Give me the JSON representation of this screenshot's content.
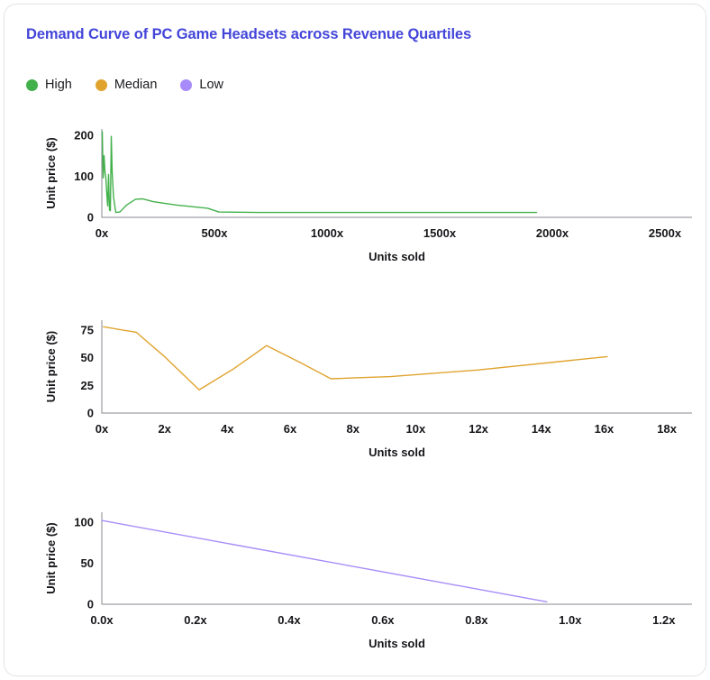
{
  "card": {
    "title": "Demand Curve of PC Game Headsets across Revenue Quartiles",
    "title_color": "#4345d9",
    "background": "#ffffff",
    "border_color": "#e3e3e8"
  },
  "legend": {
    "position": "top-left",
    "items": [
      {
        "label": "High",
        "color": "#43b14b"
      },
      {
        "label": "Median",
        "color": "#e0a32e"
      },
      {
        "label": "Low",
        "color": "#a78bfa"
      }
    ]
  },
  "chart_data": [
    {
      "type": "line",
      "title": "Demand Curve of PC Game Headsets across Revenue Quartiles",
      "series_name": "High",
      "color": "#43b14b",
      "xlabel": "Units sold",
      "ylabel": "Unit price ($)",
      "xlim": [
        0,
        2620
      ],
      "ylim": [
        0,
        215
      ],
      "xticks": [
        0,
        500,
        1000,
        1500,
        2000,
        2500
      ],
      "xticklabels": [
        "0x",
        "500x",
        "1000x",
        "1500x",
        "2000x",
        "2500x"
      ],
      "yticks": [
        0,
        100,
        200
      ],
      "yticklabels": [
        "0",
        "100",
        "200"
      ],
      "grid": false,
      "x": [
        2,
        6,
        10,
        14,
        18,
        22,
        26,
        30,
        34,
        38,
        42,
        46,
        52,
        62,
        80,
        110,
        150,
        180,
        230,
        330,
        470,
        520,
        700,
        1000,
        1400,
        1700,
        1930
      ],
      "y": [
        208,
        96,
        150,
        110,
        96,
        58,
        28,
        104,
        18,
        16,
        197,
        110,
        50,
        12,
        13,
        30,
        44,
        45,
        38,
        30,
        22,
        13,
        12,
        12,
        12,
        12,
        12
      ]
    },
    {
      "type": "line",
      "series_name": "Median",
      "color": "#e0a32e",
      "xlabel": "Units sold",
      "ylabel": "Unit price ($)",
      "xlim": [
        0,
        18.8
      ],
      "ylim": [
        0,
        84
      ],
      "xticks": [
        0,
        2,
        4,
        6,
        8,
        10,
        12,
        14,
        16,
        18
      ],
      "xticklabels": [
        "0x",
        "2x",
        "4x",
        "6x",
        "8x",
        "10x",
        "12x",
        "14x",
        "16x",
        "18x"
      ],
      "yticks": [
        0,
        25,
        50,
        75
      ],
      "yticklabels": [
        "0",
        "25",
        "50",
        "75"
      ],
      "grid": false,
      "x": [
        0.05,
        1.1,
        2.0,
        3.1,
        4.2,
        5.25,
        6.3,
        7.3,
        9.2,
        12.0,
        16.1
      ],
      "y": [
        78,
        73,
        51,
        21,
        40,
        61,
        46,
        31,
        33,
        39,
        51
      ]
    },
    {
      "type": "line",
      "series_name": "Low",
      "color": "#a78bfa",
      "xlabel": "Units sold",
      "ylabel": "Unit price ($)",
      "xlim": [
        0,
        1.26
      ],
      "ylim": [
        0,
        112
      ],
      "xticks": [
        0.0,
        0.2,
        0.4,
        0.6,
        0.8,
        1.0,
        1.2
      ],
      "xticklabels": [
        "0.0x",
        "0.2x",
        "0.4x",
        "0.6x",
        "0.8x",
        "1.0x",
        "1.2x"
      ],
      "yticks": [
        0,
        50,
        100
      ],
      "yticklabels": [
        "0",
        "50",
        "100"
      ],
      "grid": false,
      "x": [
        0.0,
        0.95
      ],
      "y": [
        102,
        3
      ]
    }
  ]
}
